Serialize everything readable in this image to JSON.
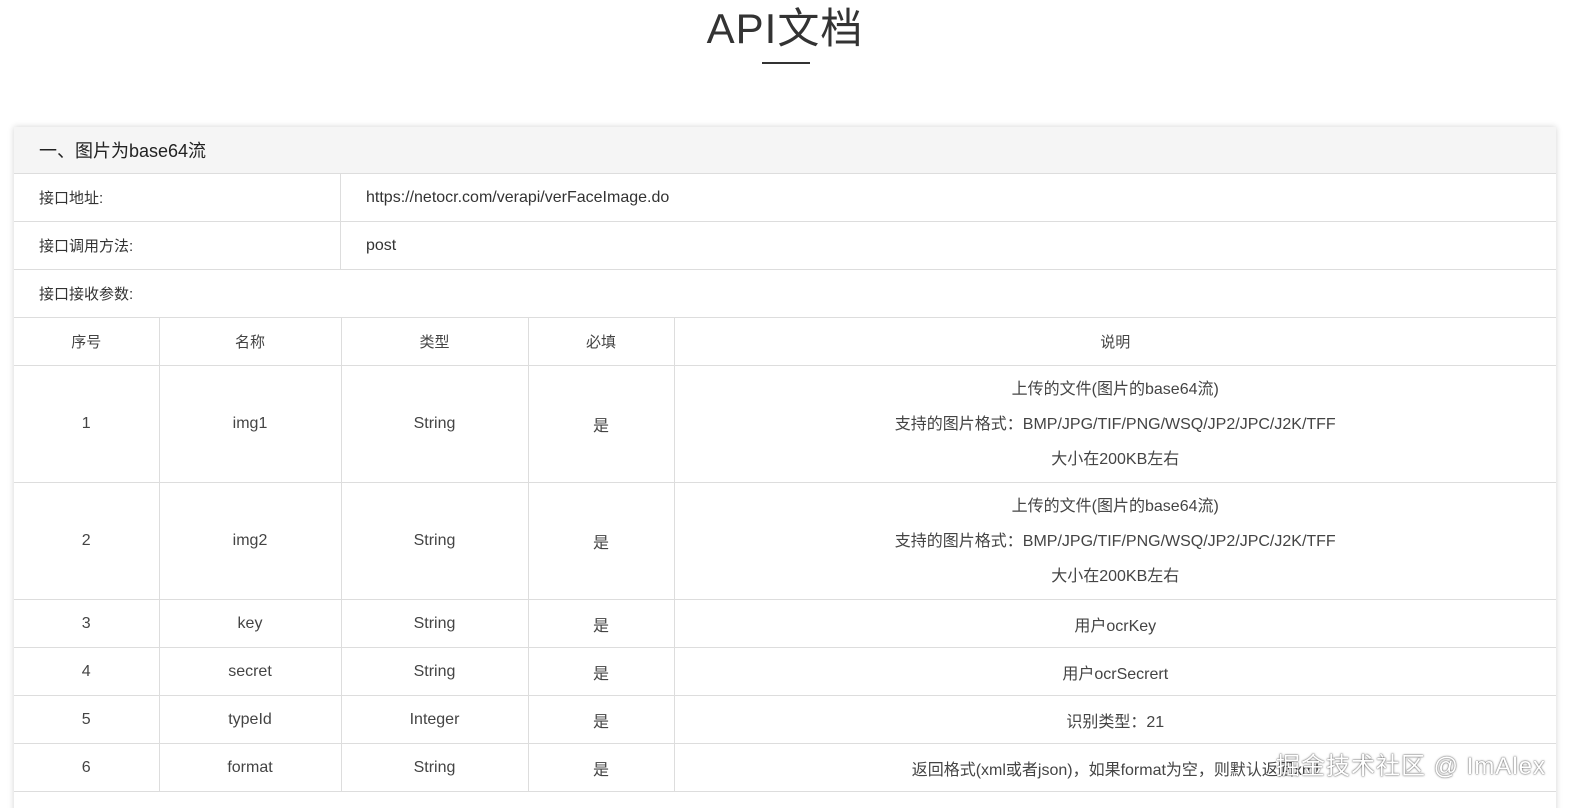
{
  "page": {
    "title": "API文档"
  },
  "section": {
    "header": "一、图片为base64流"
  },
  "info": {
    "url_label": "接口地址:",
    "url_value": "https://netocr.com/verapi/verFaceImage.do",
    "method_label": "接口调用方法:",
    "method_value": "post",
    "params_label": "接口接收参数:"
  },
  "table": {
    "headers": [
      "序号",
      "名称",
      "类型",
      "必填",
      "说明"
    ],
    "rows": [
      {
        "index": "1",
        "name": "img1",
        "type": "String",
        "required": "是",
        "desc": [
          "上传的文件(图片的base64流)",
          "支持的图片格式：BMP/JPG/TIF/PNG/WSQ/JP2/JPC/J2K/TFF",
          "大小在200KB左右"
        ]
      },
      {
        "index": "2",
        "name": "img2",
        "type": "String",
        "required": "是",
        "desc": [
          "上传的文件(图片的base64流)",
          "支持的图片格式：BMP/JPG/TIF/PNG/WSQ/JP2/JPC/J2K/TFF",
          "大小在200KB左右"
        ]
      },
      {
        "index": "3",
        "name": "key",
        "type": "String",
        "required": "是",
        "desc": [
          "用户ocrKey"
        ]
      },
      {
        "index": "4",
        "name": "secret",
        "type": "String",
        "required": "是",
        "desc": [
          "用户ocrSecrert"
        ]
      },
      {
        "index": "5",
        "name": "typeId",
        "type": "Integer",
        "required": "是",
        "desc": [
          "识别类型：21"
        ]
      },
      {
        "index": "6",
        "name": "format",
        "type": "String",
        "required": "是",
        "desc": [
          "返回格式(xml或者json)，如果format为空，则默认返回xml"
        ]
      }
    ]
  },
  "watermark": {
    "text": "掘金技术社区 @ ImAlex"
  }
}
